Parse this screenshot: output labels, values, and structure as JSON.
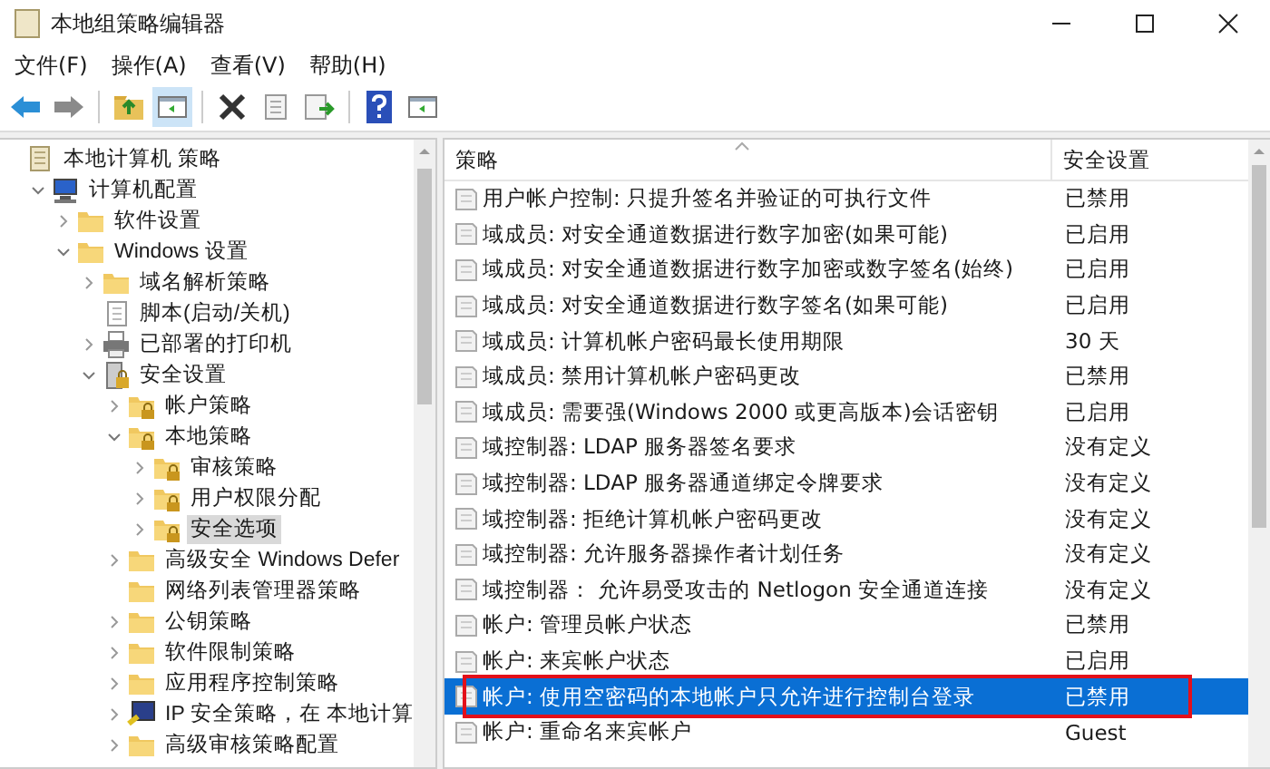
{
  "window": {
    "title": "本地组策略编辑器"
  },
  "menu": [
    "文件(F)",
    "操作(A)",
    "查看(V)",
    "帮助(H)"
  ],
  "toolbar": [
    {
      "kind": "back"
    },
    {
      "kind": "forward"
    },
    {
      "kind": "sep"
    },
    {
      "kind": "up"
    },
    {
      "kind": "pane",
      "selected": true
    },
    {
      "kind": "sep"
    },
    {
      "kind": "delete"
    },
    {
      "kind": "properties"
    },
    {
      "kind": "export"
    },
    {
      "kind": "sep"
    },
    {
      "kind": "help"
    },
    {
      "kind": "pane",
      "selected": false
    }
  ],
  "tree": [
    {
      "label": "本地计算机 策略",
      "kind": "root",
      "expander": false,
      "selected": false,
      "children": [
        {
          "label": "计算机配置",
          "kind": "computer",
          "expander": true,
          "expanded": true,
          "selected": false,
          "children": [
            {
              "label": "软件设置",
              "kind": "folder",
              "expander": true,
              "expanded": false,
              "selected": false
            },
            {
              "label": "Windows 设置",
              "kind": "folder",
              "expander": true,
              "expanded": true,
              "selected": false,
              "children": [
                {
                  "label": "域名解析策略",
                  "kind": "folder",
                  "expander": true,
                  "expanded": false,
                  "selected": false
                },
                {
                  "label": "脚本(启动/关机)",
                  "kind": "script",
                  "expander": false,
                  "selected": false
                },
                {
                  "label": "已部署的打印机",
                  "kind": "printer",
                  "expander": true,
                  "expanded": false,
                  "selected": false
                },
                {
                  "label": "安全设置",
                  "kind": "security",
                  "expander": true,
                  "expanded": true,
                  "selected": false,
                  "children": [
                    {
                      "label": "帐户策略",
                      "kind": "lockfolder",
                      "expander": true,
                      "expanded": false,
                      "selected": false
                    },
                    {
                      "label": "本地策略",
                      "kind": "lockfolder",
                      "expander": true,
                      "expanded": true,
                      "selected": false,
                      "children": [
                        {
                          "label": "审核策略",
                          "kind": "lockfolder",
                          "expander": true,
                          "expanded": false,
                          "selected": false
                        },
                        {
                          "label": "用户权限分配",
                          "kind": "lockfolder",
                          "expander": true,
                          "expanded": false,
                          "selected": false
                        },
                        {
                          "label": "安全选项",
                          "kind": "lockfolder",
                          "expander": true,
                          "expanded": false,
                          "selected": true
                        }
                      ]
                    },
                    {
                      "label": "高级安全 Windows Defer",
                      "kind": "folder",
                      "expander": true,
                      "expanded": false,
                      "selected": false
                    },
                    {
                      "label": "网络列表管理器策略",
                      "kind": "folder",
                      "expander": false,
                      "selected": false
                    },
                    {
                      "label": "公钥策略",
                      "kind": "folder",
                      "expander": true,
                      "expanded": false,
                      "selected": false
                    },
                    {
                      "label": "软件限制策略",
                      "kind": "folder",
                      "expander": true,
                      "expanded": false,
                      "selected": false
                    },
                    {
                      "label": "应用程序控制策略",
                      "kind": "folder",
                      "expander": true,
                      "expanded": false,
                      "selected": false
                    },
                    {
                      "label": "IP 安全策略，在 本地计算",
                      "kind": "ipsec",
                      "expander": true,
                      "expanded": false,
                      "selected": false
                    },
                    {
                      "label": "高级审核策略配置",
                      "kind": "folder",
                      "expander": true,
                      "expanded": false,
                      "selected": false
                    }
                  ]
                }
              ]
            }
          ]
        }
      ]
    }
  ],
  "table": {
    "columns": [
      "策略",
      "安全设置"
    ],
    "rows": [
      {
        "policy": "用户帐户控制: 只提升签名并验证的可执行文件",
        "setting": "已禁用",
        "selected": false,
        "annotated": false
      },
      {
        "policy": "域成员: 对安全通道数据进行数字加密(如果可能)",
        "setting": "已启用",
        "selected": false,
        "annotated": false
      },
      {
        "policy": "域成员: 对安全通道数据进行数字加密或数字签名(始终)",
        "setting": "已启用",
        "selected": false,
        "annotated": false
      },
      {
        "policy": "域成员: 对安全通道数据进行数字签名(如果可能)",
        "setting": "已启用",
        "selected": false,
        "annotated": false
      },
      {
        "policy": "域成员: 计算机帐户密码最长使用期限",
        "setting": "30 天",
        "selected": false,
        "annotated": false
      },
      {
        "policy": "域成员: 禁用计算机帐户密码更改",
        "setting": "已禁用",
        "selected": false,
        "annotated": false
      },
      {
        "policy": "域成员: 需要强(Windows 2000 或更高版本)会话密钥",
        "setting": "已启用",
        "selected": false,
        "annotated": false
      },
      {
        "policy": "域控制器: LDAP 服务器签名要求",
        "setting": "没有定义",
        "selected": false,
        "annotated": false
      },
      {
        "policy": "域控制器: LDAP 服务器通道绑定令牌要求",
        "setting": "没有定义",
        "selected": false,
        "annotated": false
      },
      {
        "policy": "域控制器: 拒绝计算机帐户密码更改",
        "setting": "没有定义",
        "selected": false,
        "annotated": false
      },
      {
        "policy": "域控制器: 允许服务器操作者计划任务",
        "setting": "没有定义",
        "selected": false,
        "annotated": false
      },
      {
        "policy": "域控制器： 允许易受攻击的 Netlogon 安全通道连接",
        "setting": "没有定义",
        "selected": false,
        "annotated": false
      },
      {
        "policy": "帐户: 管理员帐户状态",
        "setting": "已禁用",
        "selected": false,
        "annotated": false
      },
      {
        "policy": "帐户: 来宾帐户状态",
        "setting": "已启用",
        "selected": false,
        "annotated": false
      },
      {
        "policy": "帐户: 使用空密码的本地帐户只允许进行控制台登录",
        "setting": "已禁用",
        "selected": true,
        "annotated": true
      },
      {
        "policy": "帐户: 重命名来宾帐户",
        "setting": "Guest",
        "selected": false,
        "annotated": false
      }
    ]
  }
}
